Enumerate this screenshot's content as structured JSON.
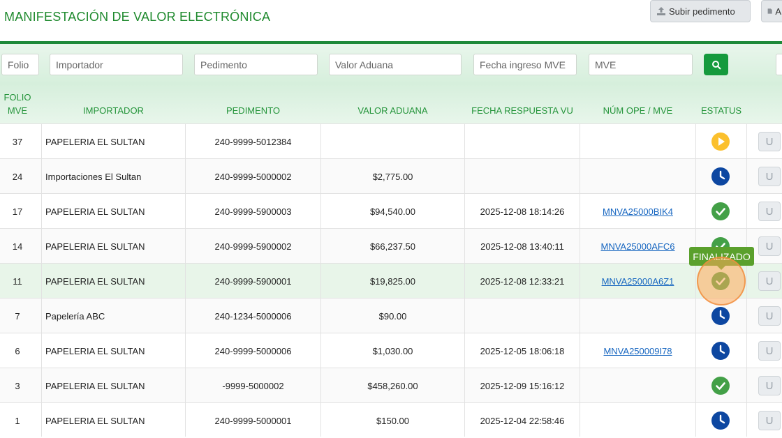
{
  "page": {
    "title": "MANIFESTACIÓN DE VALOR ELECTRÓNICA"
  },
  "header": {
    "upload_label": "Subir pedimento",
    "second_label": "A"
  },
  "filters": {
    "folio": "Folio",
    "importador": "Importador",
    "pedimento": "Pedimento",
    "valor_aduana": "Valor Aduana",
    "fecha_ingreso": "Fecha ingreso MVE",
    "mve": "MVE"
  },
  "columns": {
    "folio_1": "FOLIO",
    "folio_2": "MVE",
    "importador": "IMPORTADOR",
    "pedimento": "PEDIMENTO",
    "valor_aduana": "VALOR ADUANA",
    "fecha_respuesta": "FECHA RESPUESTA VU",
    "num_ope": "NÚM OPE / MVE",
    "estatus": "ESTATUS"
  },
  "rows": [
    {
      "folio": "37",
      "importador": "PAPELERIA EL SULTAN",
      "pedimento": "240-9999-5012384",
      "valor": "",
      "fecha": "",
      "num_ope": "",
      "status": "play"
    },
    {
      "folio": "24",
      "importador": "Importaciones El Sultan",
      "pedimento": "240-9999-5000002",
      "valor": "$2,775.00",
      "fecha": "",
      "num_ope": "",
      "status": "clock"
    },
    {
      "folio": "17",
      "importador": "PAPELERIA EL SULTAN",
      "pedimento": "240-9999-5900003",
      "valor": "$94,540.00",
      "fecha": "2025-12-08 18:14:26",
      "num_ope": "MNVA25000BIK4",
      "status": "check"
    },
    {
      "folio": "14",
      "importador": "PAPELERIA EL SULTAN",
      "pedimento": "240-9999-5900002",
      "valor": "$66,237.50",
      "fecha": "2025-12-08 13:40:11",
      "num_ope": "MNVA25000AFC6",
      "status": "check"
    },
    {
      "folio": "11",
      "importador": "PAPELERIA EL SULTAN",
      "pedimento": "240-9999-5900001",
      "valor": "$19,825.00",
      "fecha": "2025-12-08 12:33:21",
      "num_ope": "MNVA25000A6Z1",
      "status": "check"
    },
    {
      "folio": "7",
      "importador": "Papelería ABC",
      "pedimento": "240-1234-5000006",
      "valor": "$90.00",
      "fecha": "",
      "num_ope": "",
      "status": "clock"
    },
    {
      "folio": "6",
      "importador": "PAPELERIA EL SULTAN",
      "pedimento": "240-9999-5000006",
      "valor": "$1,030.00",
      "fecha": "2025-12-05 18:06:18",
      "num_ope": "MNVA250009I78",
      "status": "clock"
    },
    {
      "folio": "3",
      "importador": "PAPELERIA EL SULTAN",
      "pedimento": "-9999-5000002",
      "valor": "$458,260.00",
      "fecha": "2025-12-09 15:16:12",
      "num_ope": "",
      "status": "check"
    },
    {
      "folio": "1",
      "importador": "PAPELERIA EL SULTAN",
      "pedimento": "240-9999-5000001",
      "valor": "$150.00",
      "fecha": "2025-12-04 22:58:46",
      "num_ope": "",
      "status": "clock"
    }
  ],
  "row_action_label": "U",
  "tooltip": "FINALIZADO",
  "colors": {
    "brand_green": "#1f8a2e",
    "status_check": "#43a047",
    "status_clock": "#0d47a1",
    "status_play": "#fbc02d"
  },
  "icons": {
    "upload": "upload-icon",
    "search": "search-icon",
    "play": "play-status-icon",
    "clock": "clock-status-icon",
    "check": "check-status-icon"
  }
}
